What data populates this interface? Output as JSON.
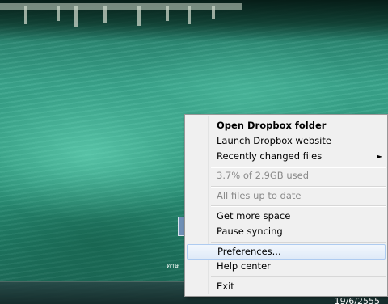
{
  "menu": {
    "items": [
      {
        "label": "Open Dropbox folder"
      },
      {
        "label": "Launch Dropbox website"
      },
      {
        "label": "Recently changed files"
      },
      {
        "label": "3.7% of 2.9GB used"
      },
      {
        "label": "All files up to date"
      },
      {
        "label": "Get more space"
      },
      {
        "label": "Pause syncing"
      },
      {
        "label": "Preferences..."
      },
      {
        "label": "Help center"
      },
      {
        "label": "Exit"
      }
    ],
    "highlighted_item": "Preferences...",
    "submenu_arrow_icon": "triangle-right-icon"
  },
  "taskbar": {
    "clock_date": "19/6/2555"
  },
  "desktop": {
    "icon_label_fragment": "ดาษ"
  },
  "colors": {
    "menu_background": "#f0f0f0",
    "menu_border": "#979797",
    "highlight": "#dfeaf8",
    "disabled_text": "#8a8a8a"
  }
}
